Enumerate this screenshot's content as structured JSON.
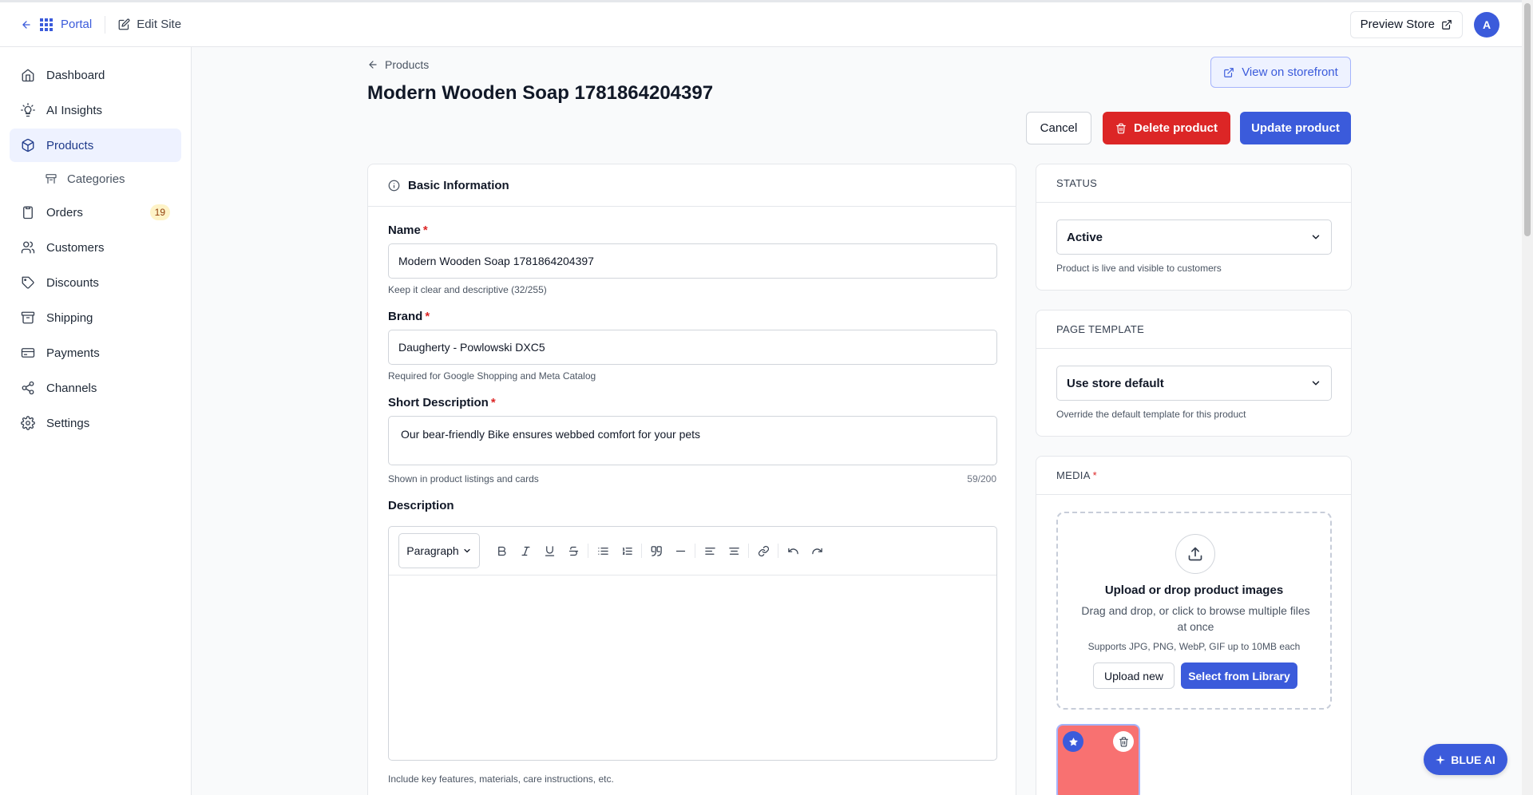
{
  "topbar": {
    "portal_label": "Portal",
    "edit_site_label": "Edit Site",
    "preview_store_label": "Preview Store",
    "avatar_initial": "A"
  },
  "sidebar": {
    "items": [
      {
        "label": "Dashboard",
        "icon": "home-icon"
      },
      {
        "label": "AI Insights",
        "icon": "lightbulb-icon"
      },
      {
        "label": "Products",
        "icon": "box-icon",
        "active": true
      },
      {
        "label": "Categories",
        "icon": "tag-folder-icon",
        "sub": true
      },
      {
        "label": "Orders",
        "icon": "clipboard-icon",
        "badge": "19"
      },
      {
        "label": "Customers",
        "icon": "users-icon"
      },
      {
        "label": "Discounts",
        "icon": "tag-icon"
      },
      {
        "label": "Shipping",
        "icon": "archive-icon"
      },
      {
        "label": "Payments",
        "icon": "credit-card-icon"
      },
      {
        "label": "Channels",
        "icon": "share-icon"
      },
      {
        "label": "Settings",
        "icon": "gear-icon"
      }
    ]
  },
  "header": {
    "breadcrumb": "Products",
    "title": "Modern Wooden Soap 1781864204397",
    "view_storefront_label": "View on storefront",
    "cancel_label": "Cancel",
    "delete_label": "Delete product",
    "update_label": "Update product"
  },
  "basic_info": {
    "heading": "Basic Information",
    "name_label": "Name",
    "name_value": "Modern Wooden Soap 1781864204397",
    "name_help": "Keep it clear and descriptive (32/255)",
    "brand_label": "Brand",
    "brand_value": "Daugherty - Powlowski DXC5",
    "brand_help": "Required for Google Shopping and Meta Catalog",
    "short_desc_label": "Short Description",
    "short_desc_value": "Our bear-friendly Bike ensures webbed comfort for your pets",
    "short_desc_help": "Shown in product listings and cards",
    "short_desc_counter": "59/200",
    "description_label": "Description",
    "paragraph_select": "Paragraph",
    "description_help": "Include key features, materials, care instructions, etc."
  },
  "status_card": {
    "heading": "STATUS",
    "value": "Active",
    "help": "Product is live and visible to customers"
  },
  "template_card": {
    "heading": "PAGE TEMPLATE",
    "value": "Use store default",
    "help": "Override the default template for this product"
  },
  "media_card": {
    "heading": "MEDIA",
    "dz_title": "Upload or drop product images",
    "dz_sub": "Drag and drop, or click to browse multiple files at once",
    "dz_note": "Supports JPG, PNG, WebP, GIF up to 10MB each",
    "upload_label": "Upload new",
    "library_label": "Select from Library",
    "thumb_color": "#f87171"
  },
  "blue_ai_label": "BLUE AI",
  "colors": {
    "accent": "#3b5bdb",
    "danger": "#dc2626",
    "badge_bg": "#fef3c7"
  }
}
